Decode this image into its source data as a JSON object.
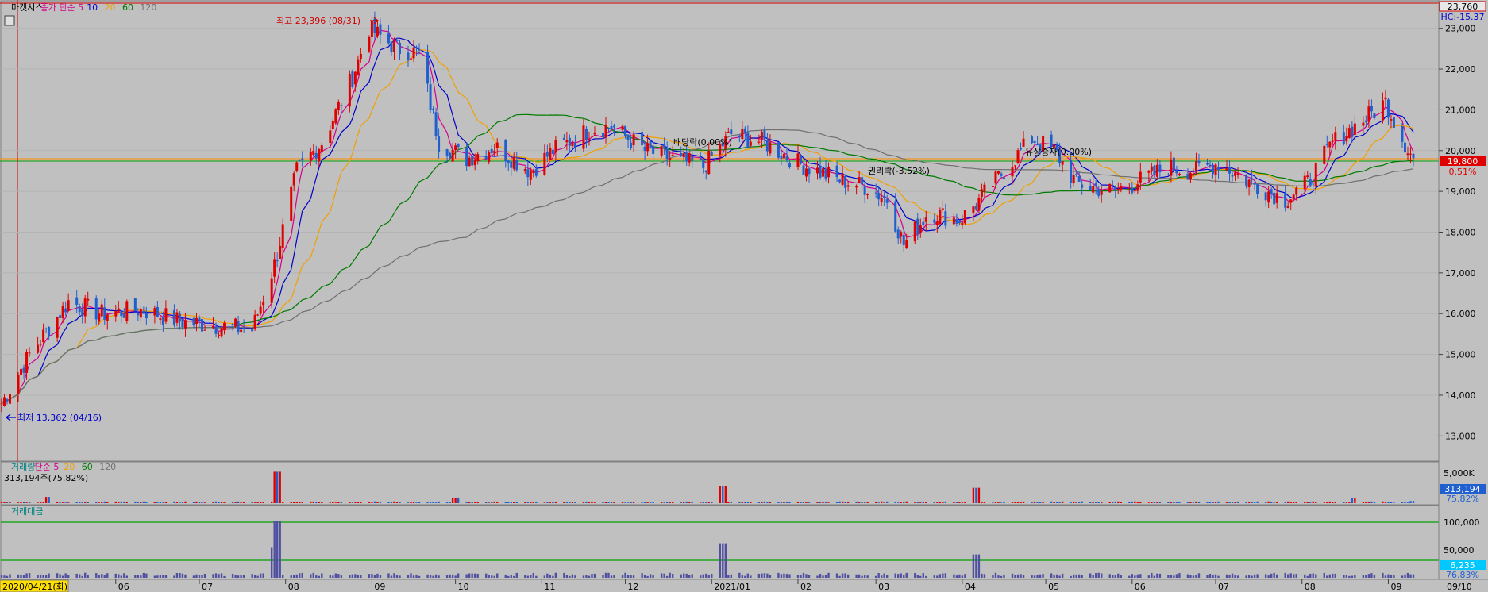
{
  "price_panel": {
    "legend": [
      {
        "text": "마켓시스",
        "color": "#000000"
      },
      {
        "text": "종가 단순 5",
        "color": "#d4008f"
      },
      {
        "text": "10",
        "color": "#0000cc"
      },
      {
        "text": "20",
        "color": "#f0a000"
      },
      {
        "text": "60",
        "color": "#007a00"
      },
      {
        "text": "120",
        "color": "#707070"
      }
    ],
    "high_label": "최고 23,396 (08/31)",
    "low_label": "최저 13,362 (04/16)",
    "events": [
      "배당락(0.00%)",
      "권리락(-3.52%)",
      "유상증자(0.00%)"
    ],
    "right_top_value": "23,760",
    "right_hc_label": "HC:-15.37",
    "current_price": "19,800",
    "current_change": "0.51%"
  },
  "volume_panel": {
    "legend": [
      {
        "text": "거래량",
        "color": "#008080"
      },
      {
        "text": "단순 5",
        "color": "#d4008f"
      },
      {
        "text": "20",
        "color": "#f0a000"
      },
      {
        "text": "60",
        "color": "#007a00"
      },
      {
        "text": "120",
        "color": "#707070"
      }
    ],
    "value_text": "313,194주(75.82%)",
    "axis_label": "5,000K",
    "current_value": "313,194",
    "current_pct": "75.82%"
  },
  "amount_panel": {
    "legend": [
      {
        "text": "거래대금",
        "color": "#008080"
      }
    ],
    "axis_labels": [
      "100,000",
      "50,000"
    ],
    "current_value": "6,235",
    "current_pct": "76.83%"
  },
  "x_axis": {
    "start_label": "2020/04/21(화)",
    "end_label": "09/10"
  },
  "colors": {
    "background": "#c0c0c0",
    "up": "#e00000",
    "down": "#1f5fd0",
    "ma5": "#d4008f",
    "ma10": "#0000cc",
    "ma20": "#f0a000",
    "ma60": "#007a00",
    "ma120": "#707070"
  },
  "chart_data": {
    "type": "candlestick",
    "y_axis": {
      "min": 12500,
      "max": 23500,
      "ticks": [
        13000,
        14000,
        15000,
        16000,
        17000,
        18000,
        19000,
        20000,
        21000,
        22000,
        23000
      ],
      "tick_labels": [
        "13,000",
        "14,000",
        "15,000",
        "16,000",
        "17,000",
        "18,000",
        "19,000",
        "20,000",
        "21,000",
        "22,000",
        "23,000"
      ]
    },
    "x_ticks": [
      {
        "label": "06",
        "date": "2020-06"
      },
      {
        "label": "07",
        "date": "2020-07"
      },
      {
        "label": "08",
        "date": "2020-08"
      },
      {
        "label": "09",
        "date": "2020-09"
      },
      {
        "label": "10",
        "date": "2020-10"
      },
      {
        "label": "11",
        "date": "2020-11"
      },
      {
        "label": "12",
        "date": "2020-12"
      },
      {
        "label": "2021/01",
        "date": "2021-01"
      },
      {
        "label": "02",
        "date": "2021-02"
      },
      {
        "label": "03",
        "date": "2021-03"
      },
      {
        "label": "04",
        "date": "2021-04"
      },
      {
        "label": "05",
        "date": "2021-05"
      },
      {
        "label": "06",
        "date": "2021-06"
      },
      {
        "label": "07",
        "date": "2021-07"
      },
      {
        "label": "08",
        "date": "2021-08"
      },
      {
        "label": "09",
        "date": "2021-09"
      }
    ],
    "close_series": {
      "name": "종가",
      "points": [
        [
          "2020-04-21",
          13800
        ],
        [
          "2020-05-01",
          15000
        ],
        [
          "2020-05-15",
          16300
        ],
        [
          "2020-05-27",
          16000
        ],
        [
          "2020-06-10",
          16100
        ],
        [
          "2020-06-25",
          15800
        ],
        [
          "2020-07-08",
          15700
        ],
        [
          "2020-07-20",
          15600
        ],
        [
          "2020-07-28",
          17200
        ],
        [
          "2020-08-05",
          19500
        ],
        [
          "2020-08-14",
          20200
        ],
        [
          "2020-08-25",
          21800
        ],
        [
          "2020-08-31",
          23000
        ],
        [
          "2020-09-10",
          22500
        ],
        [
          "2020-09-18",
          22400
        ],
        [
          "2020-09-25",
          20200
        ],
        [
          "2020-10-05",
          19800
        ],
        [
          "2020-10-15",
          20100
        ],
        [
          "2020-10-28",
          19500
        ],
        [
          "2020-11-05",
          20000
        ],
        [
          "2020-11-18",
          20500
        ],
        [
          "2020-11-26",
          20600
        ],
        [
          "2020-12-08",
          20000
        ],
        [
          "2020-12-18",
          19800
        ],
        [
          "2020-12-29",
          19600
        ],
        [
          "2021-01-08",
          20400
        ],
        [
          "2021-01-20",
          20200
        ],
        [
          "2021-02-01",
          19700
        ],
        [
          "2021-02-15",
          19300
        ],
        [
          "2021-02-26",
          19100
        ],
        [
          "2021-03-05",
          18800
        ],
        [
          "2021-03-11",
          17700
        ],
        [
          "2021-03-20",
          18500
        ],
        [
          "2021-03-31",
          18300
        ],
        [
          "2021-04-06",
          18700
        ],
        [
          "2021-04-16",
          19500
        ],
        [
          "2021-04-26",
          20300
        ],
        [
          "2021-05-04",
          20000
        ],
        [
          "2021-05-12",
          19200
        ],
        [
          "2021-05-25",
          19000
        ],
        [
          "2021-06-02",
          19200
        ],
        [
          "2021-06-14",
          19600
        ],
        [
          "2021-06-24",
          19500
        ],
        [
          "2021-07-02",
          19700
        ],
        [
          "2021-07-14",
          19200
        ],
        [
          "2021-07-26",
          18800
        ],
        [
          "2021-08-03",
          19200
        ],
        [
          "2021-08-12",
          20200
        ],
        [
          "2021-08-24",
          20800
        ],
        [
          "2021-08-31",
          21200
        ],
        [
          "2021-09-06",
          20300
        ],
        [
          "2021-09-10",
          19800
        ]
      ]
    },
    "volume_series": {
      "name": "거래량",
      "unit": "K",
      "peaks": [
        [
          "2020-05-08",
          900
        ],
        [
          "2020-07-29",
          4500
        ],
        [
          "2020-10-01",
          800
        ],
        [
          "2021-01-05",
          2500
        ],
        [
          "2021-04-06",
          2200
        ],
        [
          "2021-08-20",
          700
        ],
        [
          "2021-09-10",
          313
        ]
      ]
    },
    "amount_series": {
      "name": "거래대금",
      "peaks": [
        [
          "2020-07-29",
          102000
        ],
        [
          "2020-07-27",
          55000
        ],
        [
          "2021-01-05",
          62000
        ],
        [
          "2021-04-06",
          42000
        ],
        [
          "2021-09-10",
          6235
        ]
      ]
    }
  }
}
